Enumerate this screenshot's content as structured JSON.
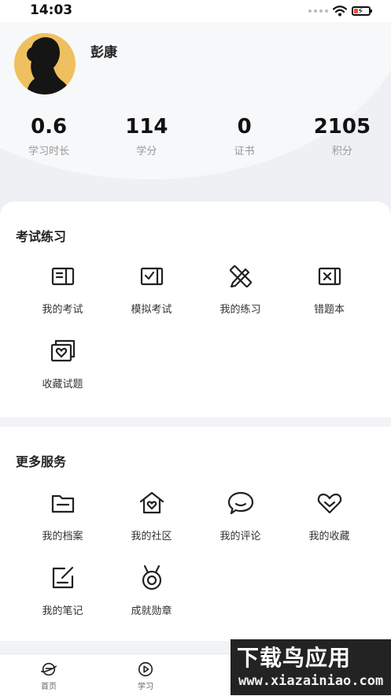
{
  "status_bar": {
    "time": "14:03"
  },
  "profile": {
    "name": "彭康",
    "stats": [
      {
        "value": "0.6",
        "label": "学习时长"
      },
      {
        "value": "114",
        "label": "学分"
      },
      {
        "value": "0",
        "label": "证书"
      },
      {
        "value": "2105",
        "label": "积分"
      }
    ]
  },
  "exam_section": {
    "title": "考试练习",
    "items": [
      {
        "label": "我的考试",
        "icon": "exam-paper-icon"
      },
      {
        "label": "模拟考试",
        "icon": "mock-exam-icon"
      },
      {
        "label": "我的练习",
        "icon": "pencil-ruler-icon"
      },
      {
        "label": "错题本",
        "icon": "wrong-book-icon"
      },
      {
        "label": "收藏试题",
        "icon": "favorite-questions-icon"
      }
    ]
  },
  "more_section": {
    "title": "更多服务",
    "items": [
      {
        "label": "我的档案",
        "icon": "folder-icon"
      },
      {
        "label": "我的社区",
        "icon": "community-house-icon"
      },
      {
        "label": "我的评论",
        "icon": "comment-bubble-icon"
      },
      {
        "label": "我的收藏",
        "icon": "heart-icon"
      },
      {
        "label": "我的笔记",
        "icon": "note-edit-icon"
      },
      {
        "label": "成就勋章",
        "icon": "medal-icon"
      }
    ]
  },
  "tabbar": {
    "tabs": [
      {
        "label": "首页",
        "icon": "home-planet-icon"
      },
      {
        "label": "学习",
        "icon": "play-circle-icon"
      }
    ]
  },
  "watermark": {
    "main": "下载鸟应用",
    "sub": "www.xiazainiao.com"
  }
}
